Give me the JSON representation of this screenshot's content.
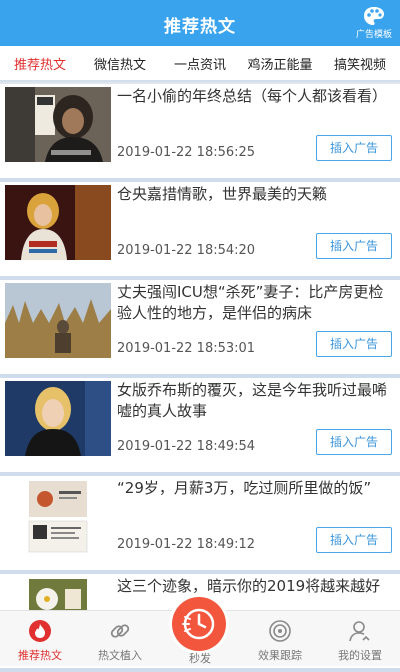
{
  "header": {
    "title": "推荐热文",
    "template_label": "广告模板",
    "template_icon": "palette-icon"
  },
  "tabs": [
    {
      "label": "推荐热文",
      "active": true
    },
    {
      "label": "微信热文",
      "active": false
    },
    {
      "label": "一点资讯",
      "active": false
    },
    {
      "label": "鸡汤正能量",
      "active": false
    },
    {
      "label": "搞笑视频",
      "active": false
    }
  ],
  "articles": [
    {
      "title": "一名小偷的年终总结（每个人都该看看）",
      "time": "2019-01-22 18:56:25",
      "button": "插入广告"
    },
    {
      "title": "仓央嘉措情歌，世界最美的天籁",
      "time": "2019-01-22 18:54:20",
      "button": "插入广告"
    },
    {
      "title": "丈夫强闯ICU想“杀死”妻子：比产房更检验人性的地方，是伴侣的病床",
      "time": "2019-01-22 18:53:01",
      "button": "插入广告"
    },
    {
      "title": "女版乔布斯的覆灭，这是今年我听过最唏嘘的真人故事",
      "time": "2019-01-22 18:49:54",
      "button": "插入广告"
    },
    {
      "title": "“29岁，月薪3万，吃过厕所里做的饭”",
      "time": "2019-01-22 18:49:12",
      "button": "插入广告"
    },
    {
      "title": "这三个迹象，暗示你的2019将越来越好",
      "time": "",
      "button": ""
    }
  ],
  "bottom_nav": [
    {
      "label": "推荐热文",
      "icon": "flame-icon",
      "active": true
    },
    {
      "label": "热文植入",
      "icon": "link-icon",
      "active": false
    },
    {
      "label": "秒发",
      "icon": "timer-flash-icon",
      "active": false
    },
    {
      "label": "效果跟踪",
      "icon": "target-icon",
      "active": false
    },
    {
      "label": "我的设置",
      "icon": "user-settings-icon",
      "active": false
    }
  ],
  "colors": {
    "primary": "#3aa3ee",
    "active_tab": "#e03030",
    "center_button": "#f2573e"
  }
}
